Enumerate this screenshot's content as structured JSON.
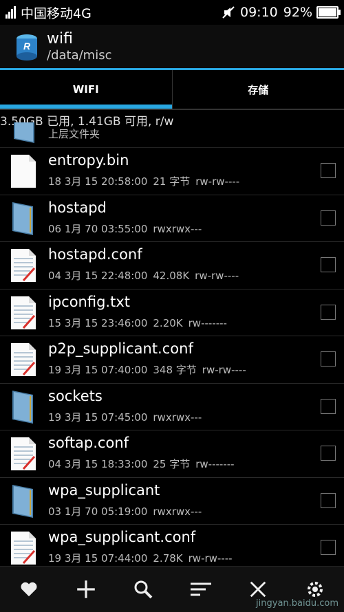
{
  "status": {
    "carrier": "中国移动4G",
    "time": "09:10",
    "battery": "92%",
    "battery_level": 0.92
  },
  "title": {
    "name": "wifi",
    "path": "/data/misc"
  },
  "tabs": [
    {
      "label": "WIFI"
    },
    {
      "label": "存储"
    }
  ],
  "storage_text": "3.50GB 已用, 1.41GB 可用, r/w",
  "parent_label": "上层文件夹",
  "files": [
    {
      "name": "entropy.bin",
      "date": "18 3月 15 20:58:00",
      "size": "21 字节",
      "perm": "rw-rw----",
      "type": "file"
    },
    {
      "name": "hostapd",
      "date": "06 1月 70 03:55:00",
      "size": "",
      "perm": "rwxrwx---",
      "type": "folder"
    },
    {
      "name": "hostapd.conf",
      "date": "04 3月 15 22:48:00",
      "size": "42.08K",
      "perm": "rw-rw----",
      "type": "text"
    },
    {
      "name": "ipconfig.txt",
      "date": "15 3月 15 23:46:00",
      "size": "2.20K",
      "perm": "rw-------",
      "type": "text"
    },
    {
      "name": "p2p_supplicant.conf",
      "date": "19 3月 15 07:40:00",
      "size": "348 字节",
      "perm": "rw-rw----",
      "type": "text"
    },
    {
      "name": "sockets",
      "date": "19 3月 15 07:45:00",
      "size": "",
      "perm": "rwxrwx---",
      "type": "folder"
    },
    {
      "name": "softap.conf",
      "date": "04 3月 15 18:33:00",
      "size": "25 字节",
      "perm": "rw-------",
      "type": "text"
    },
    {
      "name": "wpa_supplicant",
      "date": "03 1月 70 05:19:00",
      "size": "",
      "perm": "rwxrwx---",
      "type": "folder"
    },
    {
      "name": "wpa_supplicant.conf",
      "date": "19 3月 15 07:44:00",
      "size": "2.78K",
      "perm": "rw-rw----",
      "type": "text"
    }
  ],
  "toolbar": [
    "favorite-icon",
    "add-icon",
    "search-icon",
    "sort-icon",
    "close-icon",
    "settings-icon"
  ],
  "watermark": "jingyan.baidu.com",
  "colors": {
    "accent": "#29a7e1",
    "background": "#000000"
  }
}
